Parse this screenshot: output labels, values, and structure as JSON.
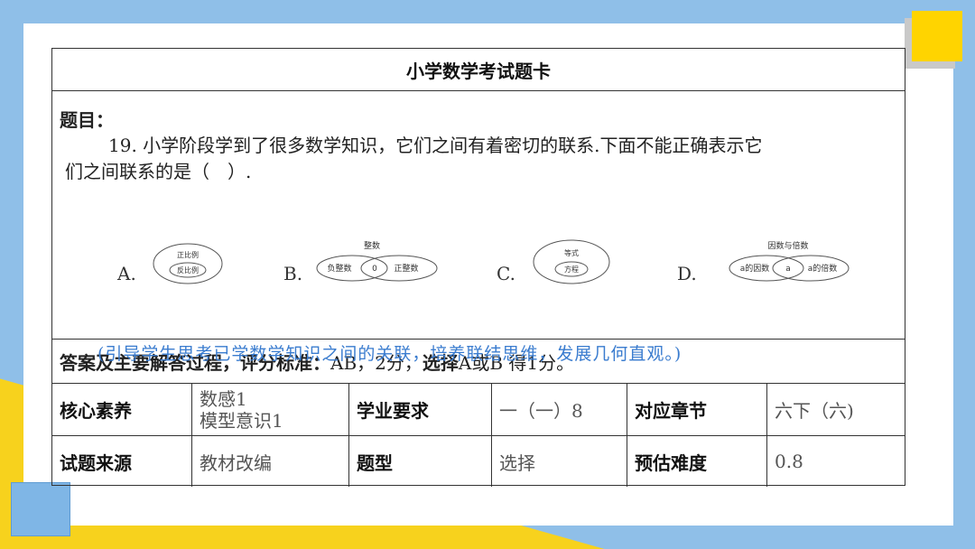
{
  "card_title": "小学数学考试题卡",
  "question": {
    "label": "题目：",
    "text_line1": "19. 小学阶段学到了很多数学知识，它们之间有着密切的联系.下面不能正确表示它",
    "text_line2": "们之间联系的是（　）.",
    "options": [
      {
        "letter": "A.",
        "outer": "正比例",
        "inner": "反比例"
      },
      {
        "letter": "B.",
        "top": "整数",
        "left": "负整数",
        "mid": "0",
        "right": "正整数"
      },
      {
        "letter": "C.",
        "outer": "等式",
        "inner": "方程"
      },
      {
        "letter": "D.",
        "top": "因数与倍数",
        "left": "a的因数",
        "mid": "a",
        "right": "a的倍数"
      }
    ],
    "hint": "(引导学生思考已学数学知识之间的关联，培养联结思维，发展几何直观。)"
  },
  "answer": {
    "label": "答案及主要解答过程，评分标准：",
    "value": "AB，2分，",
    "rule_bold": "选择",
    "rule_text": "A或B 得1分。"
  },
  "table": {
    "row1": {
      "core_label": "核心素养",
      "core_value_1": "数感1",
      "core_value_2": "模型意识1",
      "req_label": "学业要求",
      "req_value": "一（一）8",
      "chapter_label": "对应章节",
      "chapter_value": "六下（六)"
    },
    "row2": {
      "source_label": "试题来源",
      "source_value": "教材改编",
      "type_label": "题型",
      "type_value": "选择",
      "difficulty_label": "预估难度",
      "difficulty_value": "0.8"
    }
  },
  "colors": {
    "yellow": "#ffd400",
    "blue": "#8fbfe8",
    "hint": "#3a7ccf"
  }
}
